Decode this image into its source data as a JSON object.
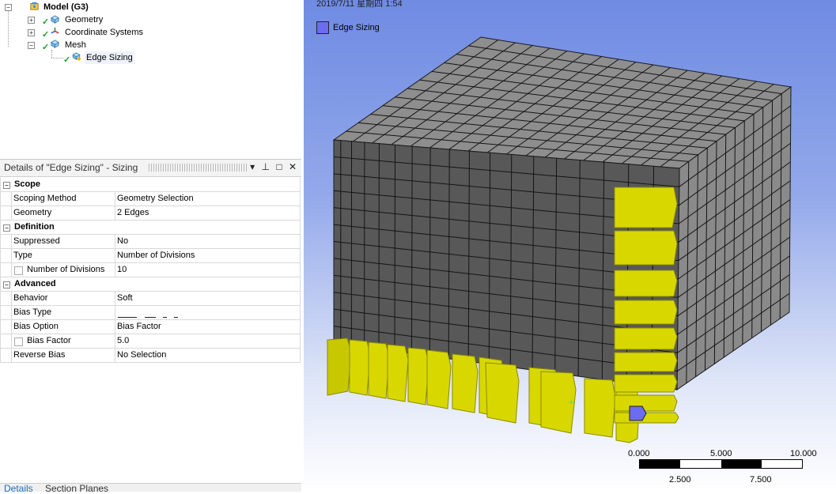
{
  "tree": {
    "model": "Model (G3)",
    "items": [
      "Geometry",
      "Coordinate Systems",
      "Mesh",
      "Edge Sizing"
    ]
  },
  "details": {
    "title": "Details of \"Edge Sizing\" - Sizing",
    "header_icons": [
      "dropdown-icon",
      "pin-icon",
      "maximize-icon",
      "close-icon"
    ],
    "groups": [
      {
        "title": "Scope",
        "rows": [
          {
            "label": "Scoping Method",
            "value": "Geometry Selection"
          },
          {
            "label": "Geometry",
            "value": "2 Edges"
          }
        ]
      },
      {
        "title": "Definition",
        "rows": [
          {
            "label": "Suppressed",
            "value": "No"
          },
          {
            "label": "Type",
            "value": "Number of Divisions"
          },
          {
            "label": "Number of Divisions",
            "value": "10"
          }
        ]
      },
      {
        "title": "Advanced",
        "rows": [
          {
            "label": "Behavior",
            "value": "Soft"
          },
          {
            "label": "Bias Type",
            "value": ""
          },
          {
            "label": "Bias Option",
            "value": "Bias Factor"
          },
          {
            "label": "Bias Factor",
            "value": "5.0"
          },
          {
            "label": "Reverse Bias",
            "value": "No Selection"
          }
        ]
      }
    ]
  },
  "tabs": [
    "Details",
    "Section Planes"
  ],
  "viewport": {
    "datetime": "2019/7/11 星期四 1:54",
    "legend_label": "Edge Sizing",
    "legend_color": "#6c6cf0",
    "scale": {
      "top_labels": [
        "0.000",
        "5.000",
        "10.000 (m)"
      ],
      "bottom_labels": [
        "2.500",
        "7.500"
      ]
    }
  },
  "colors": {
    "mesh_face_dark": "#585858",
    "mesh_face_light": "#8e8e8e",
    "edge_sizing_yellow": "#d8d800"
  }
}
